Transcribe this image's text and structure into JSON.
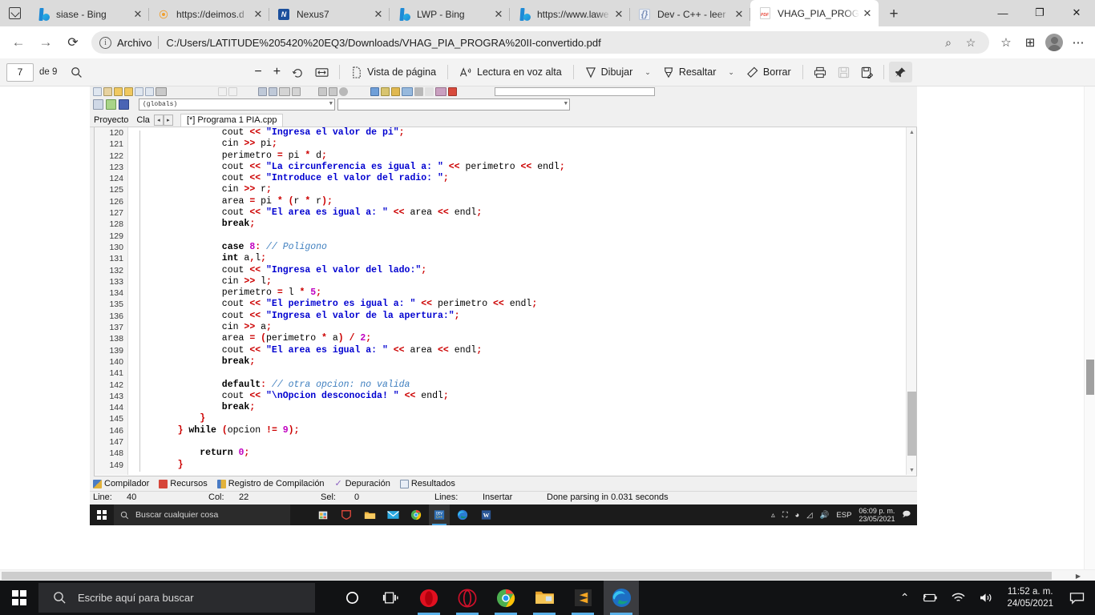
{
  "browser": {
    "tabs": [
      {
        "title": "siase - Bing",
        "favicon": "bing-icon",
        "active": false
      },
      {
        "title": "https://deimos.d",
        "favicon": "opera-icon",
        "active": false
      },
      {
        "title": "Nexus7",
        "favicon": "nexus-icon",
        "active": false
      },
      {
        "title": "LWP - Bing",
        "favicon": "bing-icon",
        "active": false
      },
      {
        "title": "https://www.lawe",
        "favicon": "bing-icon",
        "active": false
      },
      {
        "title": "Dev - C++ - leer",
        "favicon": "devcpp-icon",
        "active": false
      },
      {
        "title": "VHAG_PIA_PROG",
        "favicon": "pdf-icon",
        "active": true
      }
    ],
    "new_tab_label": "+",
    "close_label": "✕",
    "window_controls": {
      "minimize": "—",
      "maximize": "❐",
      "close": "✕"
    },
    "address": {
      "scheme_label": "Archivo",
      "url": "C:/Users/LATITUDE%205420%20EQ3/Downloads/VHAG_PIA_PROGRA%20II-convertido.pdf",
      "back": "←",
      "forward": "→",
      "reload": "⟳"
    }
  },
  "pdf_toolbar": {
    "current_page": "7",
    "page_total": "de 9",
    "search_icon": "search-icon",
    "zoom_out": "−",
    "zoom_in": "+",
    "rotate": "rotate-icon",
    "fit_page": "fit-page-icon",
    "page_view_label": "Vista de página",
    "read_aloud_label": "Lectura en voz alta",
    "draw_label": "Dibujar",
    "highlight_label": "Resaltar",
    "erase_label": "Borrar",
    "print_icon": "print-icon",
    "save_icon": "save-icon",
    "save_as_icon": "save-as-icon",
    "pin_icon": "pin-icon",
    "caret": "⌄"
  },
  "ide": {
    "combo_globals": "(globals)",
    "combo_empty": "",
    "panel_tabs": [
      "Proyecto",
      "Cla"
    ],
    "spinner_left": "◂",
    "spinner_right": "▸",
    "file_tab": "[*] Programa 1 PIA.cpp",
    "status_tabs": [
      {
        "label": "Compilador",
        "icon": "compiler-icon"
      },
      {
        "label": "Recursos",
        "icon": "resources-icon"
      },
      {
        "label": "Registro de Compilación",
        "icon": "build-log-icon"
      },
      {
        "label": "Depuración",
        "icon": "debug-icon"
      },
      {
        "label": "Resultados",
        "icon": "results-icon"
      }
    ],
    "statusbar": {
      "line_label": "Line:",
      "line_value": "40",
      "col_label": "Col:",
      "col_value": "22",
      "sel_label": "Sel:",
      "sel_value": "0",
      "lines_label": "Lines:",
      "insert_mode": "Insertar",
      "parse_status": "Done parsing in 0.031 seconds"
    },
    "taskbar": {
      "search_placeholder": "Buscar cualquier cosa",
      "language": "ESP",
      "time": "06:09 p. m.",
      "date": "23/05/2021"
    },
    "code": [
      {
        "n": "120",
        "indent": 12,
        "tokens": [
          {
            "t": "cout",
            "c": "id"
          },
          {
            "t": " ",
            "c": "id"
          },
          {
            "t": "<<",
            "c": "op"
          },
          {
            "t": " ",
            "c": "id"
          },
          {
            "t": "\"Ingresa el valor de pi\"",
            "c": "str"
          },
          {
            "t": ";",
            "c": "pun"
          }
        ]
      },
      {
        "n": "121",
        "indent": 12,
        "tokens": [
          {
            "t": "cin",
            "c": "id"
          },
          {
            "t": " ",
            "c": "id"
          },
          {
            "t": ">>",
            "c": "op"
          },
          {
            "t": " pi",
            "c": "id"
          },
          {
            "t": ";",
            "c": "pun"
          }
        ]
      },
      {
        "n": "122",
        "indent": 12,
        "tokens": [
          {
            "t": "perimetro ",
            "c": "id"
          },
          {
            "t": "=",
            "c": "op"
          },
          {
            "t": " pi ",
            "c": "id"
          },
          {
            "t": "*",
            "c": "op"
          },
          {
            "t": " d",
            "c": "id"
          },
          {
            "t": ";",
            "c": "pun"
          }
        ]
      },
      {
        "n": "123",
        "indent": 12,
        "tokens": [
          {
            "t": "cout",
            "c": "id"
          },
          {
            "t": " ",
            "c": "id"
          },
          {
            "t": "<<",
            "c": "op"
          },
          {
            "t": " ",
            "c": "id"
          },
          {
            "t": "\"La circunferencia es igual a: \"",
            "c": "str"
          },
          {
            "t": " ",
            "c": "id"
          },
          {
            "t": "<<",
            "c": "op"
          },
          {
            "t": " perimetro ",
            "c": "id"
          },
          {
            "t": "<<",
            "c": "op"
          },
          {
            "t": " endl",
            "c": "id"
          },
          {
            "t": ";",
            "c": "pun"
          }
        ]
      },
      {
        "n": "124",
        "indent": 12,
        "tokens": [
          {
            "t": "cout",
            "c": "id"
          },
          {
            "t": " ",
            "c": "id"
          },
          {
            "t": "<<",
            "c": "op"
          },
          {
            "t": " ",
            "c": "id"
          },
          {
            "t": "\"Introduce el valor del radio: \"",
            "c": "str"
          },
          {
            "t": ";",
            "c": "pun"
          }
        ]
      },
      {
        "n": "125",
        "indent": 12,
        "tokens": [
          {
            "t": "cin",
            "c": "id"
          },
          {
            "t": " ",
            "c": "id"
          },
          {
            "t": ">>",
            "c": "op"
          },
          {
            "t": " r",
            "c": "id"
          },
          {
            "t": ";",
            "c": "pun"
          }
        ]
      },
      {
        "n": "126",
        "indent": 12,
        "tokens": [
          {
            "t": "area ",
            "c": "id"
          },
          {
            "t": "=",
            "c": "op"
          },
          {
            "t": " pi ",
            "c": "id"
          },
          {
            "t": "*",
            "c": "op"
          },
          {
            "t": " ",
            "c": "id"
          },
          {
            "t": "(",
            "c": "pun"
          },
          {
            "t": "r ",
            "c": "id"
          },
          {
            "t": "*",
            "c": "op"
          },
          {
            "t": " r",
            "c": "id"
          },
          {
            "t": ")",
            "c": "pun"
          },
          {
            "t": ";",
            "c": "pun"
          }
        ]
      },
      {
        "n": "127",
        "indent": 12,
        "tokens": [
          {
            "t": "cout",
            "c": "id"
          },
          {
            "t": " ",
            "c": "id"
          },
          {
            "t": "<<",
            "c": "op"
          },
          {
            "t": " ",
            "c": "id"
          },
          {
            "t": "\"El area es igual a: \"",
            "c": "str"
          },
          {
            "t": " ",
            "c": "id"
          },
          {
            "t": "<<",
            "c": "op"
          },
          {
            "t": " area ",
            "c": "id"
          },
          {
            "t": "<<",
            "c": "op"
          },
          {
            "t": " endl",
            "c": "id"
          },
          {
            "t": ";",
            "c": "pun"
          }
        ]
      },
      {
        "n": "128",
        "indent": 12,
        "tokens": [
          {
            "t": "break",
            "c": "kw"
          },
          {
            "t": ";",
            "c": "pun"
          }
        ]
      },
      {
        "n": "129",
        "indent": 0,
        "tokens": []
      },
      {
        "n": "130",
        "indent": 12,
        "tokens": [
          {
            "t": "case",
            "c": "kw"
          },
          {
            "t": " ",
            "c": "id"
          },
          {
            "t": "8",
            "c": "num"
          },
          {
            "t": ":",
            "c": "pun"
          },
          {
            "t": " ",
            "c": "id"
          },
          {
            "t": "// Poligono",
            "c": "com"
          }
        ]
      },
      {
        "n": "131",
        "indent": 12,
        "tokens": [
          {
            "t": "int",
            "c": "kw"
          },
          {
            "t": " a",
            "c": "id"
          },
          {
            "t": ",",
            "c": "pun"
          },
          {
            "t": "l",
            "c": "id"
          },
          {
            "t": ";",
            "c": "pun"
          }
        ]
      },
      {
        "n": "132",
        "indent": 12,
        "tokens": [
          {
            "t": "cout",
            "c": "id"
          },
          {
            "t": " ",
            "c": "id"
          },
          {
            "t": "<<",
            "c": "op"
          },
          {
            "t": " ",
            "c": "id"
          },
          {
            "t": "\"Ingresa el valor del lado:\"",
            "c": "str"
          },
          {
            "t": ";",
            "c": "pun"
          }
        ]
      },
      {
        "n": "133",
        "indent": 12,
        "tokens": [
          {
            "t": "cin",
            "c": "id"
          },
          {
            "t": " ",
            "c": "id"
          },
          {
            "t": ">>",
            "c": "op"
          },
          {
            "t": " l",
            "c": "id"
          },
          {
            "t": ";",
            "c": "pun"
          }
        ]
      },
      {
        "n": "134",
        "indent": 12,
        "tokens": [
          {
            "t": "perimetro ",
            "c": "id"
          },
          {
            "t": "=",
            "c": "op"
          },
          {
            "t": " l ",
            "c": "id"
          },
          {
            "t": "*",
            "c": "op"
          },
          {
            "t": " ",
            "c": "id"
          },
          {
            "t": "5",
            "c": "num"
          },
          {
            "t": ";",
            "c": "pun"
          }
        ]
      },
      {
        "n": "135",
        "indent": 12,
        "tokens": [
          {
            "t": "cout",
            "c": "id"
          },
          {
            "t": " ",
            "c": "id"
          },
          {
            "t": "<<",
            "c": "op"
          },
          {
            "t": " ",
            "c": "id"
          },
          {
            "t": "\"El perimetro es igual a: \"",
            "c": "str"
          },
          {
            "t": " ",
            "c": "id"
          },
          {
            "t": "<<",
            "c": "op"
          },
          {
            "t": " perimetro ",
            "c": "id"
          },
          {
            "t": "<<",
            "c": "op"
          },
          {
            "t": " endl",
            "c": "id"
          },
          {
            "t": ";",
            "c": "pun"
          }
        ]
      },
      {
        "n": "136",
        "indent": 12,
        "tokens": [
          {
            "t": "cout",
            "c": "id"
          },
          {
            "t": " ",
            "c": "id"
          },
          {
            "t": "<<",
            "c": "op"
          },
          {
            "t": " ",
            "c": "id"
          },
          {
            "t": "\"Ingresa el valor de la apertura:\"",
            "c": "str"
          },
          {
            "t": ";",
            "c": "pun"
          }
        ]
      },
      {
        "n": "137",
        "indent": 12,
        "tokens": [
          {
            "t": "cin",
            "c": "id"
          },
          {
            "t": " ",
            "c": "id"
          },
          {
            "t": ">>",
            "c": "op"
          },
          {
            "t": " a",
            "c": "id"
          },
          {
            "t": ";",
            "c": "pun"
          }
        ]
      },
      {
        "n": "138",
        "indent": 12,
        "tokens": [
          {
            "t": "area ",
            "c": "id"
          },
          {
            "t": "=",
            "c": "op"
          },
          {
            "t": " ",
            "c": "id"
          },
          {
            "t": "(",
            "c": "pun"
          },
          {
            "t": "perimetro ",
            "c": "id"
          },
          {
            "t": "*",
            "c": "op"
          },
          {
            "t": " a",
            "c": "id"
          },
          {
            "t": ")",
            "c": "pun"
          },
          {
            "t": " ",
            "c": "id"
          },
          {
            "t": "/",
            "c": "op"
          },
          {
            "t": " ",
            "c": "id"
          },
          {
            "t": "2",
            "c": "num"
          },
          {
            "t": ";",
            "c": "pun"
          }
        ]
      },
      {
        "n": "139",
        "indent": 12,
        "tokens": [
          {
            "t": "cout",
            "c": "id"
          },
          {
            "t": " ",
            "c": "id"
          },
          {
            "t": "<<",
            "c": "op"
          },
          {
            "t": " ",
            "c": "id"
          },
          {
            "t": "\"El area es igual a: \"",
            "c": "str"
          },
          {
            "t": " ",
            "c": "id"
          },
          {
            "t": "<<",
            "c": "op"
          },
          {
            "t": " area ",
            "c": "id"
          },
          {
            "t": "<<",
            "c": "op"
          },
          {
            "t": " endl",
            "c": "id"
          },
          {
            "t": ";",
            "c": "pun"
          }
        ]
      },
      {
        "n": "140",
        "indent": 12,
        "tokens": [
          {
            "t": "break",
            "c": "kw"
          },
          {
            "t": ";",
            "c": "pun"
          }
        ]
      },
      {
        "n": "141",
        "indent": 0,
        "tokens": []
      },
      {
        "n": "142",
        "indent": 12,
        "tokens": [
          {
            "t": "default",
            "c": "kw"
          },
          {
            "t": ":",
            "c": "pun"
          },
          {
            "t": " ",
            "c": "id"
          },
          {
            "t": "// otra opcion: no valida",
            "c": "com"
          }
        ]
      },
      {
        "n": "143",
        "indent": 12,
        "tokens": [
          {
            "t": "cout",
            "c": "id"
          },
          {
            "t": " ",
            "c": "id"
          },
          {
            "t": "<<",
            "c": "op"
          },
          {
            "t": " ",
            "c": "id"
          },
          {
            "t": "\"\\nOpcion desconocida! \"",
            "c": "str"
          },
          {
            "t": " ",
            "c": "id"
          },
          {
            "t": "<<",
            "c": "op"
          },
          {
            "t": " endl",
            "c": "id"
          },
          {
            "t": ";",
            "c": "pun"
          }
        ]
      },
      {
        "n": "144",
        "indent": 12,
        "tokens": [
          {
            "t": "break",
            "c": "kw"
          },
          {
            "t": ";",
            "c": "pun"
          }
        ]
      },
      {
        "n": "145",
        "indent": 8,
        "tokens": [
          {
            "t": "}",
            "c": "pun"
          }
        ]
      },
      {
        "n": "146",
        "indent": 4,
        "tokens": [
          {
            "t": "}",
            "c": "pun"
          },
          {
            "t": " ",
            "c": "id"
          },
          {
            "t": "while",
            "c": "kw"
          },
          {
            "t": " ",
            "c": "id"
          },
          {
            "t": "(",
            "c": "pun"
          },
          {
            "t": "opcion ",
            "c": "id"
          },
          {
            "t": "!=",
            "c": "op"
          },
          {
            "t": " ",
            "c": "id"
          },
          {
            "t": "9",
            "c": "num"
          },
          {
            "t": ")",
            "c": "pun"
          },
          {
            "t": ";",
            "c": "pun"
          }
        ]
      },
      {
        "n": "147",
        "indent": 0,
        "tokens": []
      },
      {
        "n": "148",
        "indent": 8,
        "tokens": [
          {
            "t": "return",
            "c": "kw"
          },
          {
            "t": " ",
            "c": "id"
          },
          {
            "t": "0",
            "c": "num"
          },
          {
            "t": ";",
            "c": "pun"
          }
        ]
      },
      {
        "n": "149",
        "indent": 4,
        "tokens": [
          {
            "t": "}",
            "c": "pun"
          }
        ]
      }
    ]
  },
  "taskbar": {
    "search_placeholder": "Escribe aquí para buscar",
    "items": [
      {
        "name": "cortana-icon"
      },
      {
        "name": "task-view-icon"
      },
      {
        "name": "opera-icon"
      },
      {
        "name": "opera-gx-icon"
      },
      {
        "name": "chrome-icon"
      },
      {
        "name": "file-explorer-icon"
      },
      {
        "name": "sublime-text-icon"
      },
      {
        "name": "edge-icon"
      }
    ],
    "tray": {
      "show_hidden": "⌃",
      "battery": "battery-icon",
      "wifi": "wifi-icon",
      "volume": "volume-icon",
      "time": "11:52 a. m.",
      "date": "24/05/2021",
      "action_center": "notification-icon"
    }
  }
}
